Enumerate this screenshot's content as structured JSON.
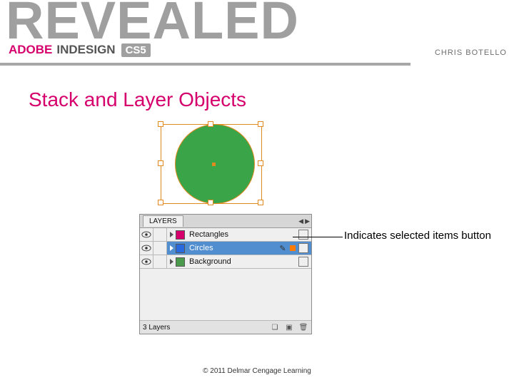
{
  "brand": {
    "ghost": "REVEALED",
    "adobe": "ADOBE",
    "product": "INDESIGN",
    "version": "CS5",
    "author": "CHRIS BOTELLO"
  },
  "title": "Stack and Layer Objects",
  "layers_panel": {
    "tab": "LAYERS",
    "rows": [
      {
        "name": "Rectangles",
        "swatch": "#d6006c",
        "selected": false,
        "has_pen": false,
        "has_sel_indicator": false
      },
      {
        "name": "Circles",
        "swatch": "#2a6adf",
        "selected": true,
        "has_pen": true,
        "has_sel_indicator": true
      },
      {
        "name": "Background",
        "swatch": "#4c9a4c",
        "selected": false,
        "has_pen": false,
        "has_sel_indicator": false
      }
    ],
    "footer_count": "3 Layers"
  },
  "callout": "Indicates selected items button",
  "footer": "© 2011 Delmar Cengage Learning",
  "colors": {
    "accent": "#d6006c",
    "shape_fill": "#3aa548",
    "selection": "#e08a1f"
  }
}
